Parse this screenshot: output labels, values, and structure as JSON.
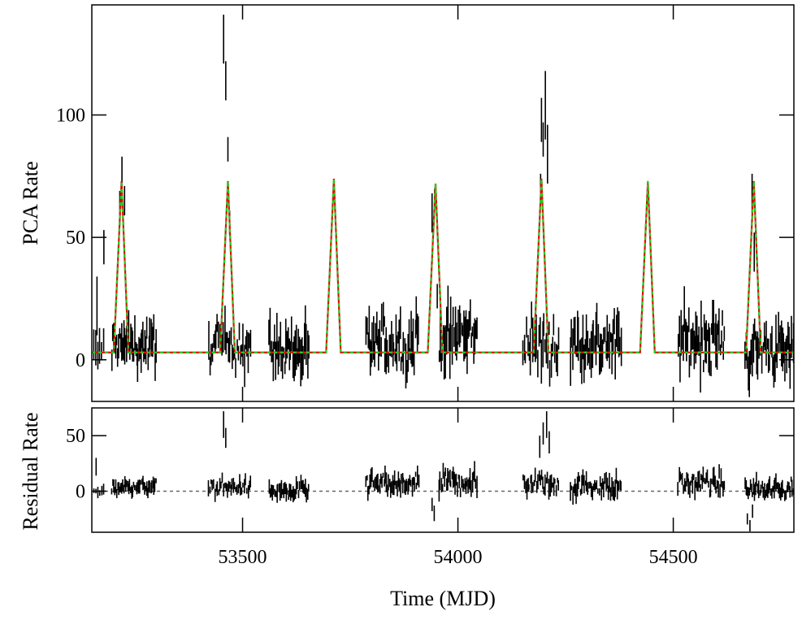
{
  "chart_data": {
    "type": "line",
    "xlabel": "Time (MJD)",
    "xlim": [
      53150,
      54780
    ],
    "x_ticks": [
      53500,
      54000,
      54500
    ],
    "x_tick_labels": [
      "53500",
      "54000",
      "54500"
    ],
    "colors": {
      "data": "#000000",
      "model_red": "#e01010",
      "model_green": "#20d020",
      "zero_line": "#666666"
    },
    "panels": [
      {
        "id": "top",
        "ylabel": "PCA Rate",
        "ylim": [
          -17,
          145
        ],
        "y_ticks": [
          0,
          50,
          100
        ],
        "y_tick_labels": [
          "0",
          "50",
          "100"
        ],
        "model": {
          "baseline": 3,
          "peak_rise_days": 18,
          "peak_fall_days": 16,
          "peaks": [
            {
              "t": 53219,
              "amp": 73
            },
            {
              "t": 53466,
              "amp": 73
            },
            {
              "t": 53712,
              "amp": 74
            },
            {
              "t": 53948,
              "amp": 72
            },
            {
              "t": 54194,
              "amp": 74
            },
            {
              "t": 54441,
              "amp": 73
            },
            {
              "t": 54687,
              "amp": 73
            }
          ]
        },
        "data_segments": [
          {
            "start": 53152,
            "end": 53180,
            "n": 6,
            "level": 3,
            "spread": 7
          },
          {
            "start": 53195,
            "end": 53300,
            "n": 45,
            "level": 6,
            "spread": 7
          },
          {
            "start": 53420,
            "end": 53520,
            "n": 35,
            "level": 6,
            "spread": 8
          },
          {
            "start": 53560,
            "end": 53655,
            "n": 36,
            "level": 4,
            "spread": 9
          },
          {
            "start": 53785,
            "end": 53910,
            "n": 50,
            "level": 7,
            "spread": 10
          },
          {
            "start": 53955,
            "end": 54045,
            "n": 36,
            "level": 10,
            "spread": 11
          },
          {
            "start": 54150,
            "end": 54235,
            "n": 30,
            "level": 6,
            "spread": 9
          },
          {
            "start": 54260,
            "end": 54380,
            "n": 45,
            "level": 7,
            "spread": 10
          },
          {
            "start": 54510,
            "end": 54620,
            "n": 45,
            "level": 8,
            "spread": 10
          },
          {
            "start": 54665,
            "end": 54780,
            "n": 46,
            "level": 4,
            "spread": 9
          }
        ],
        "highlights": [
          {
            "x": 53162,
            "y": 22,
            "err": 12
          },
          {
            "x": 53178,
            "y": 46,
            "err": 7
          },
          {
            "x": 53215,
            "y": 62,
            "err": 7
          },
          {
            "x": 53220,
            "y": 76,
            "err": 7
          },
          {
            "x": 53226,
            "y": 65,
            "err": 6
          },
          {
            "x": 53456,
            "y": 131,
            "err": 10
          },
          {
            "x": 53461,
            "y": 114,
            "err": 8
          },
          {
            "x": 53466,
            "y": 86,
            "err": 5
          },
          {
            "x": 53470,
            "y": 56,
            "err": 5
          },
          {
            "x": 53940,
            "y": 60,
            "err": 8
          },
          {
            "x": 53946,
            "y": 66,
            "err": 4
          },
          {
            "x": 53952,
            "y": 26,
            "err": 5
          },
          {
            "x": 54192,
            "y": 70,
            "err": 6
          },
          {
            "x": 54194,
            "y": 98,
            "err": 9
          },
          {
            "x": 54198,
            "y": 90,
            "err": 7
          },
          {
            "x": 54203,
            "y": 104,
            "err": 14
          },
          {
            "x": 54208,
            "y": 84,
            "err": 12
          },
          {
            "x": 54683,
            "y": 68,
            "err": 8
          },
          {
            "x": 54688,
            "y": 44,
            "err": 8
          }
        ]
      },
      {
        "id": "bottom",
        "ylabel": "Residual Rate",
        "ylim": [
          -37,
          75
        ],
        "y_ticks": [
          0,
          50
        ],
        "y_tick_labels": [
          "0",
          "50"
        ],
        "zero_line": true,
        "data_segments": [
          {
            "start": 53152,
            "end": 53180,
            "n": 6,
            "level": 1,
            "spread": 5
          },
          {
            "start": 53195,
            "end": 53300,
            "n": 45,
            "level": 4,
            "spread": 5
          },
          {
            "start": 53420,
            "end": 53520,
            "n": 35,
            "level": 4,
            "spread": 6
          },
          {
            "start": 53560,
            "end": 53655,
            "n": 36,
            "level": 0,
            "spread": 7
          },
          {
            "start": 53785,
            "end": 53910,
            "n": 50,
            "level": 6,
            "spread": 8
          },
          {
            "start": 53955,
            "end": 54045,
            "n": 36,
            "level": 8,
            "spread": 9
          },
          {
            "start": 54150,
            "end": 54235,
            "n": 30,
            "level": 8,
            "spread": 9
          },
          {
            "start": 54260,
            "end": 54380,
            "n": 45,
            "level": 5,
            "spread": 8
          },
          {
            "start": 54510,
            "end": 54620,
            "n": 45,
            "level": 7,
            "spread": 8
          },
          {
            "start": 54665,
            "end": 54780,
            "n": 46,
            "level": 2,
            "spread": 7
          }
        ],
        "highlights": [
          {
            "x": 53160,
            "y": 22,
            "err": 8
          },
          {
            "x": 53456,
            "y": 60,
            "err": 12
          },
          {
            "x": 53461,
            "y": 48,
            "err": 9
          },
          {
            "x": 53940,
            "y": -12,
            "err": 6
          },
          {
            "x": 53945,
            "y": -20,
            "err": 7
          },
          {
            "x": 54190,
            "y": 40,
            "err": 10
          },
          {
            "x": 54198,
            "y": 52,
            "err": 10
          },
          {
            "x": 54206,
            "y": 60,
            "err": 12
          },
          {
            "x": 54212,
            "y": 44,
            "err": 10
          },
          {
            "x": 54672,
            "y": -25,
            "err": 5
          },
          {
            "x": 54678,
            "y": -32,
            "err": 6
          },
          {
            "x": 54684,
            "y": -18,
            "err": 6
          }
        ]
      }
    ]
  }
}
